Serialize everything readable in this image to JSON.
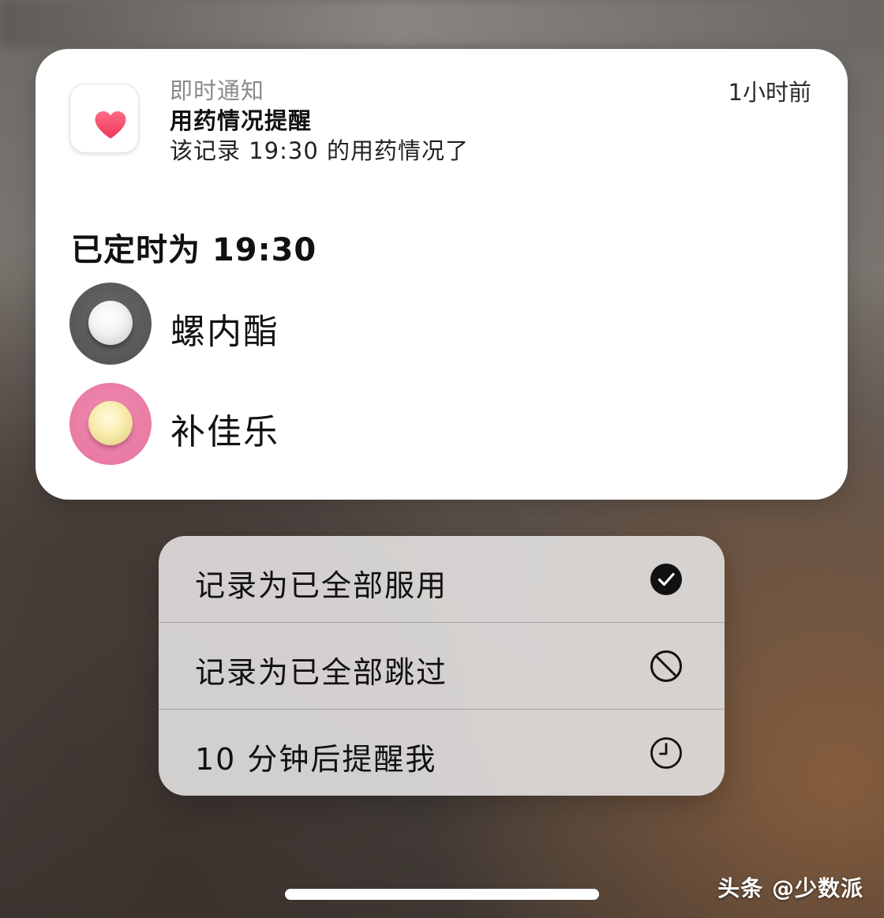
{
  "notification": {
    "app_icon": "heart-icon",
    "category": "即时通知",
    "title": "用药情况提醒",
    "body": "该记录 19:30 的用药情况了",
    "time": "1小时前",
    "scheduled_label": "已定时为 19:30",
    "medications": [
      {
        "name": "螺内酯",
        "icon": "white-pill-icon",
        "background_color": "#575757",
        "pill_color": "#f2f2f2"
      },
      {
        "name": "补佳乐",
        "icon": "yellow-pill-icon",
        "background_color": "#e97aa3",
        "pill_color": "#f8ecad"
      }
    ]
  },
  "actions": [
    {
      "label": "记录为已全部服用",
      "icon": "checkmark-circle-icon"
    },
    {
      "label": "记录为已全部跳过",
      "icon": "prohibited-icon"
    },
    {
      "label": "10 分钟后提醒我",
      "icon": "clock-icon"
    }
  ],
  "watermark": "头条 @少数派",
  "colors": {
    "heart": "#f0506e",
    "card_background": "#ffffff",
    "menu_background": "#dedcda"
  }
}
